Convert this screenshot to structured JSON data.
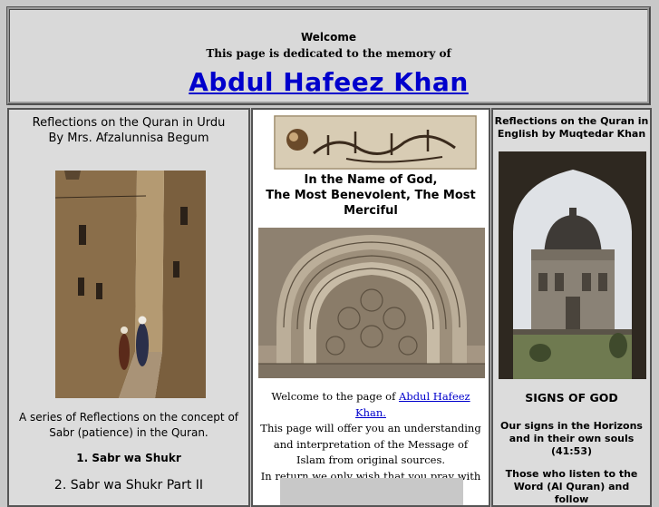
{
  "header": {
    "welcome": "Welcome",
    "dedication": "This page is dedicated to the memory of",
    "name_link": "Abdul Hafeez Khan"
  },
  "left_column": {
    "title_line1": "Reflections on the Quran in Urdu",
    "title_line2": "By Mrs. Afzalunnisa Begum",
    "description": "A series of Reflections on the concept of Sabr (patience) in the Quran.",
    "item1": "1. Sabr wa Shukr",
    "item2": "2. Sabr wa Shukr Part II"
  },
  "middle_column": {
    "invocation_line1": "In the Name of God,",
    "invocation_line2": "The Most Benevolent, The Most Merciful",
    "welcome_prefix": "Welcome to the page of",
    "welcome_link": "Abdul Hafeez Khan.",
    "body": "This page will offer you an understanding and interpretation of the Message of Islam from original sources.",
    "prayer": "In return we only wish that you pray with us:"
  },
  "right_column": {
    "title": "Reflections on the Quran in English by  Muqtedar Khan",
    "signs_heading": "SIGNS OF GOD",
    "verse1": "Our signs in the Horizons and in their own souls (41:53)",
    "verse2": "Those who listen to the Word (Al Quran) and follow"
  },
  "colors": {
    "link": "#0000cc",
    "panel_grey": "#dcdcdc",
    "panel_white": "#ffffff"
  }
}
